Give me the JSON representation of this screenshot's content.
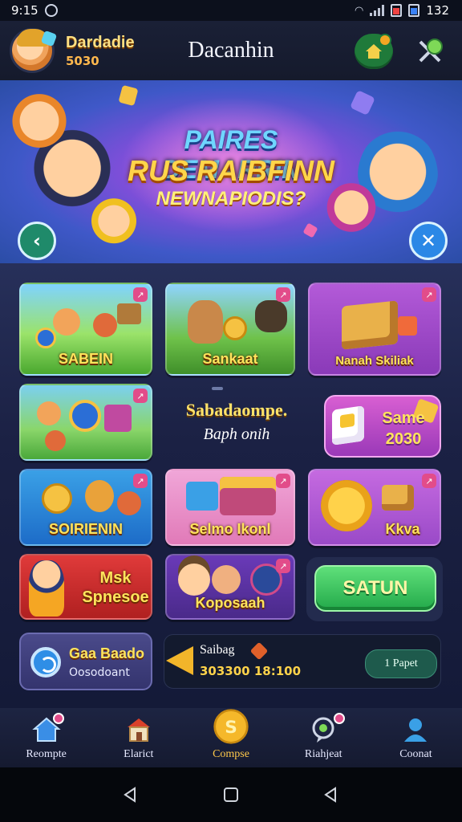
{
  "status_bar": {
    "time": "9:15",
    "battery_text": "132"
  },
  "header": {
    "title": "Dacanhin",
    "user_name": "Dardadie",
    "user_coins": "5030"
  },
  "banner": {
    "line1": "PAIRES DEMARRIN",
    "line2": "RUS RAIBFINN",
    "line3": "NEWNAPIODIS?"
  },
  "tiles": [
    {
      "label": "SABEIN"
    },
    {
      "label": "Sankaat"
    },
    {
      "label": "Nanah Skiliak"
    },
    {
      "label": ""
    },
    {
      "label": "SOIRIENIN"
    },
    {
      "label": "Selmo Ikonl"
    },
    {
      "label": "Kkva"
    },
    {
      "label": "Msk Spnesoe"
    },
    {
      "label": "Koposaah"
    }
  ],
  "promo": {
    "title": "Sabadaompe.",
    "subtitle": "Baph onih"
  },
  "same_card": {
    "line1": "Same",
    "line2": "2030"
  },
  "start_button": {
    "label": "SATUN"
  },
  "card_left": {
    "title": "Gaa Baado",
    "subtitle": "Oosodoant"
  },
  "card_right": {
    "title": "Saibag",
    "value": "303300 18:100",
    "button": "1 Papet"
  },
  "tabs": [
    {
      "label": "Reompte"
    },
    {
      "label": "Elarict"
    },
    {
      "label": "Compse"
    },
    {
      "label": "Riahjeat"
    },
    {
      "label": "Coonat"
    }
  ],
  "colors": {
    "accent_gold": "#ffd54a",
    "start_green": "#23a94a",
    "badge_pink": "#e24c8a",
    "banner_purple": "#7b4fd8"
  },
  "icons": {
    "header_home": "home-icon",
    "header_tools": "tools-icon",
    "banner_back": "back-icon",
    "banner_close": "close-icon"
  }
}
